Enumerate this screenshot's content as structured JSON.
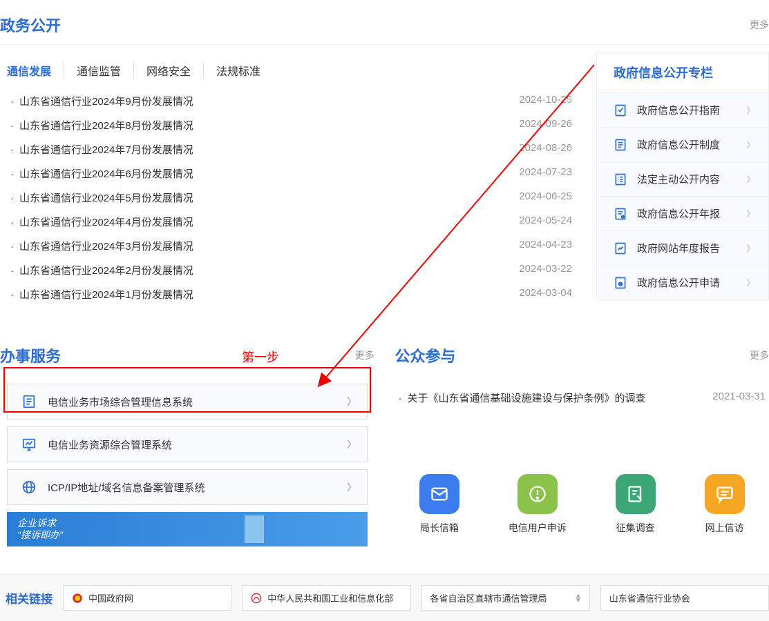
{
  "header": {
    "title": "政务公开",
    "more": "更多"
  },
  "tabs": [
    "通信发展",
    "通信监管",
    "网络安全",
    "法规标准"
  ],
  "news": [
    {
      "title": "山东省通信行业2024年9月份发展情况",
      "date": "2024-10-25"
    },
    {
      "title": "山东省通信行业2024年8月份发展情况",
      "date": "2024-09-26"
    },
    {
      "title": "山东省通信行业2024年7月份发展情况",
      "date": "2024-08-26"
    },
    {
      "title": "山东省通信行业2024年6月份发展情况",
      "date": "2024-07-23"
    },
    {
      "title": "山东省通信行业2024年5月份发展情况",
      "date": "2024-06-25"
    },
    {
      "title": "山东省通信行业2024年4月份发展情况",
      "date": "2024-05-24"
    },
    {
      "title": "山东省通信行业2024年3月份发展情况",
      "date": "2024-04-23"
    },
    {
      "title": "山东省通信行业2024年2月份发展情况",
      "date": "2024-03-22"
    },
    {
      "title": "山东省通信行业2024年1月份发展情况",
      "date": "2024-03-04"
    }
  ],
  "sidebar": {
    "title": "政府信息公开专栏",
    "items": [
      "政府信息公开指南",
      "政府信息公开制度",
      "法定主动公开内容",
      "政府信息公开年报",
      "政府网站年度报告",
      "政府信息公开申请"
    ]
  },
  "services": {
    "title": "办事服务",
    "more": "更多",
    "step": "第一步",
    "items": [
      "电信业务市场综合管理信息系统",
      "电信业务资源综合管理系统",
      "ICP/IP地址/域名信息备案管理系统"
    ],
    "banner_line1": "企业诉求",
    "banner_line2": "\"接诉即办\""
  },
  "participation": {
    "title": "公众参与",
    "more": "更多",
    "item": {
      "title": "关于《山东省通信基础设施建设与保护条例》的调查",
      "date": "2021-03-31"
    },
    "grid": [
      "局长信箱",
      "电信用户申诉",
      "征集调查",
      "网上信访"
    ]
  },
  "links": {
    "label": "相关链接",
    "items": [
      "中国政府网",
      "中华人民共和国工业和信息化部",
      "各省自治区直辖市通信管理局",
      "山东省通信行业协会"
    ]
  }
}
